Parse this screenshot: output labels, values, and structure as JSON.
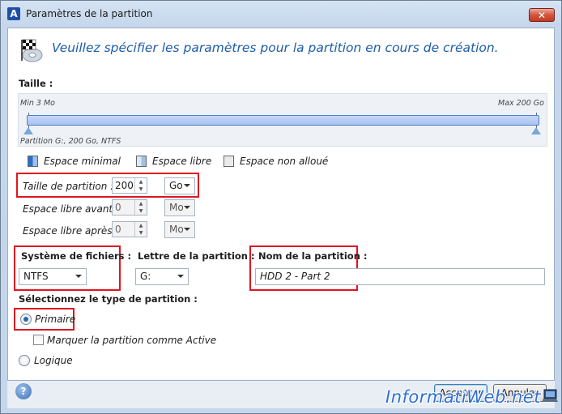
{
  "window": {
    "title": "Paramètres de la partition",
    "app_icon": "A",
    "close_glyph": "✕"
  },
  "header": {
    "text": "Veuillez spécifier les paramètres pour la partition en cours de création."
  },
  "size": {
    "label": "Taille :",
    "min_label": "Min 3 Mo",
    "max_label": "Max 200 Go",
    "partition_info": "Partition G:, 200 Go, NTFS",
    "fill_fraction": 1.0
  },
  "legend": [
    {
      "label": "Espace minimal",
      "color": "#2d6fc7"
    },
    {
      "label": "Espace libre",
      "color": "#9fc0ea"
    },
    {
      "label": "Espace non alloué",
      "color": "#e6e6e6"
    }
  ],
  "fields": {
    "partition_size": {
      "label": "Taille de partition :",
      "value": "200",
      "unit": "Go"
    },
    "free_before": {
      "label": "Espace libre avant :",
      "value": "0",
      "unit": "Mo"
    },
    "free_after": {
      "label": "Espace libre après :",
      "value": "0",
      "unit": "Mo"
    }
  },
  "filesystem": {
    "label": "Système de fichiers :",
    "value": "NTFS"
  },
  "drive_letter": {
    "label": "Lettre de la partition :",
    "value": "G:"
  },
  "partition_name": {
    "label": "Nom de la partition :",
    "value": "HDD 2 - Part 2"
  },
  "partition_type": {
    "label": "Sélectionnez le type de partition :",
    "primary": "Primaire",
    "active": "Marquer la partition comme Active",
    "logical": "Logique",
    "selected": "Primaire"
  },
  "footer": {
    "help_glyph": "?",
    "accept": "Accepter",
    "cancel": "Annuler"
  },
  "watermark": "InformatiWeb.net",
  "colors": {
    "accent": "#1c5ca8",
    "highlight": "#e0141f"
  }
}
